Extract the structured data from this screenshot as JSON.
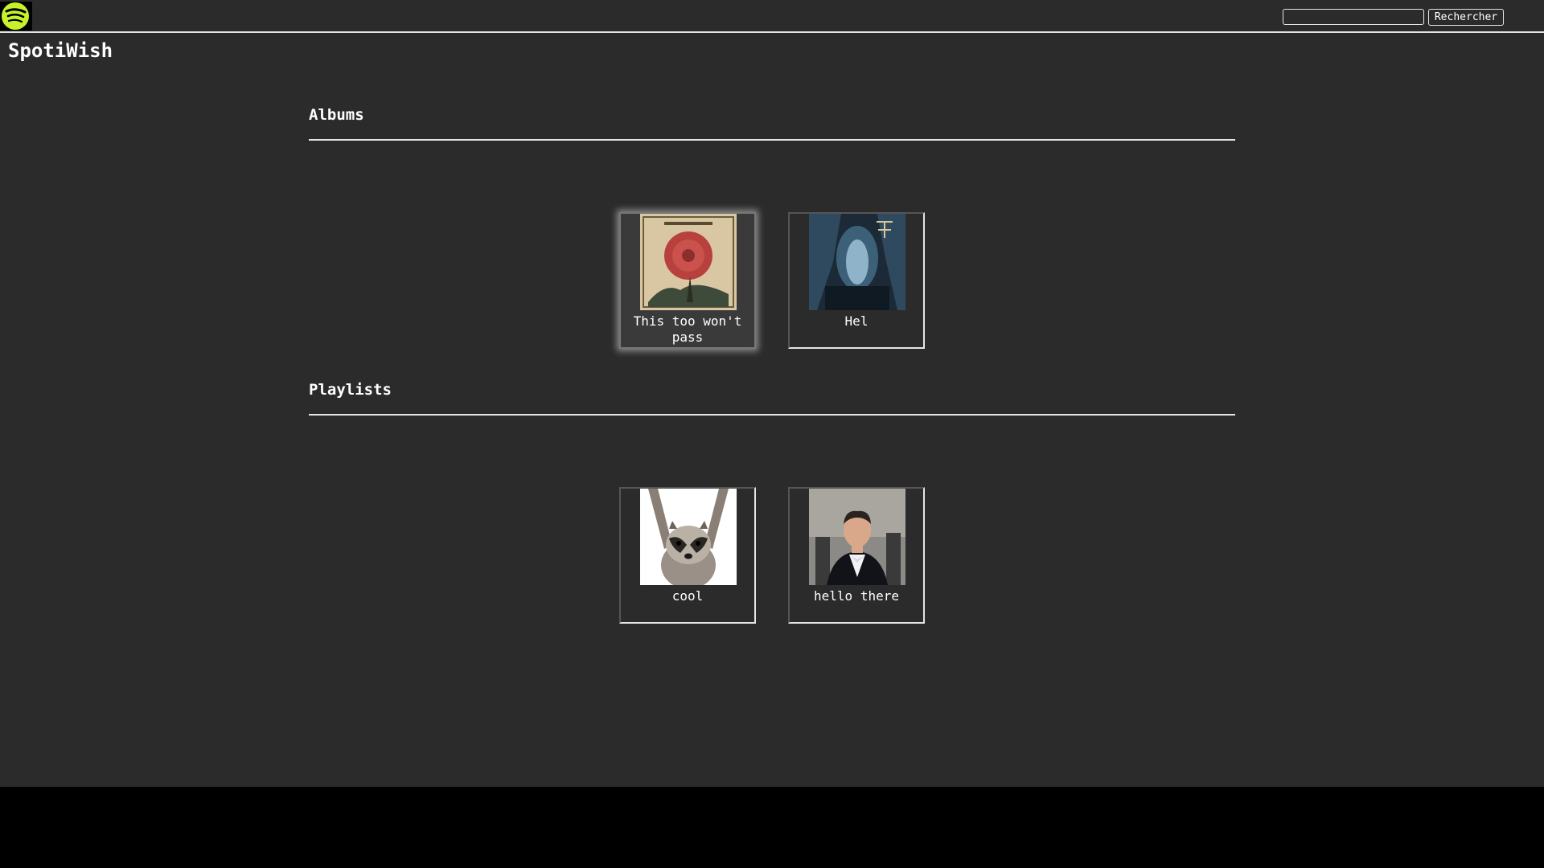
{
  "app": {
    "title": "SpotiWish"
  },
  "header": {
    "logo_icon": "spotify-logo-icon",
    "search": {
      "value": "",
      "placeholder": ""
    },
    "search_button_label": "Rechercher"
  },
  "sections": {
    "albums": {
      "title": "Albums",
      "items": [
        {
          "label": "This too won't pass",
          "art": "album-cover-red-flower-tree",
          "selected": true
        },
        {
          "label": "Hel",
          "art": "album-cover-dark-cave"
        }
      ]
    },
    "playlists": {
      "title": "Playlists",
      "items": [
        {
          "label": "cool",
          "art": "playlist-cover-raccoon"
        },
        {
          "label": "hello there",
          "art": "playlist-cover-man-in-tuxedo"
        }
      ]
    }
  },
  "colors": {
    "background": "#2b2b2b",
    "accent": "#c5f22a",
    "text": "#ffffff",
    "rule": "#e6e6e6"
  }
}
